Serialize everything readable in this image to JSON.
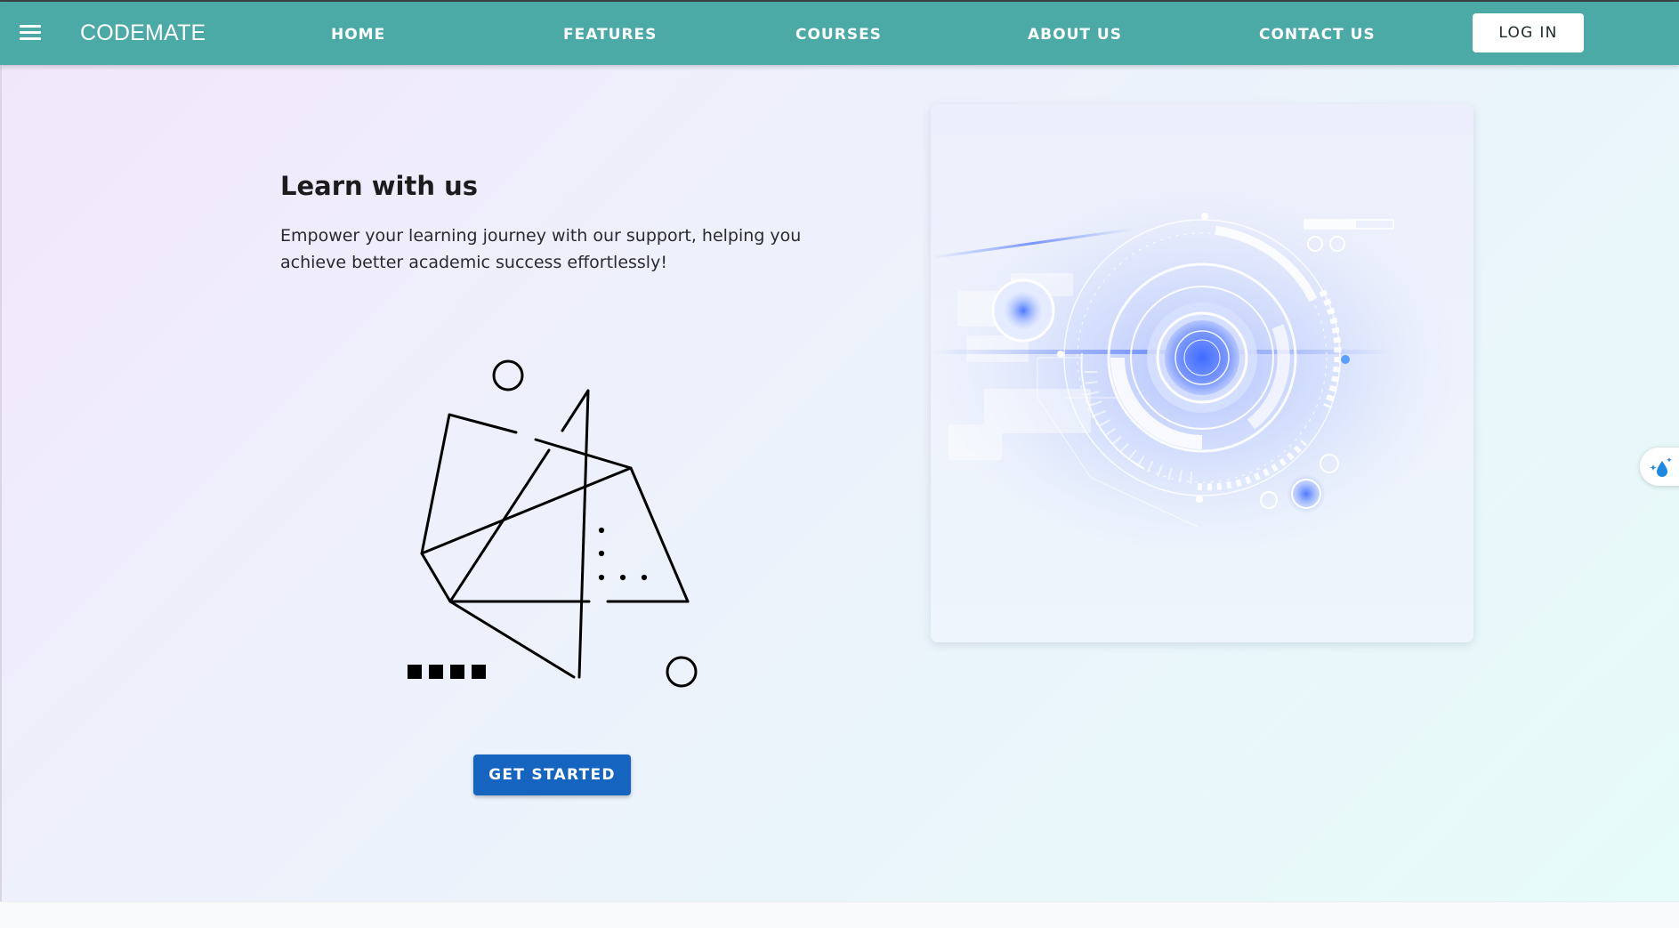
{
  "navbar": {
    "brand": "CODEMATE",
    "links": [
      "HOME",
      "FEATURES",
      "COURSES",
      "ABOUT US",
      "CONTACT US"
    ],
    "login_label": "LOG IN",
    "bg_color": "#4ba9a6"
  },
  "hero": {
    "title": "Learn with us",
    "subtitle": "Empower your learning journey with our support, helping you achieve better academic success effortlessly!",
    "cta_label": "GET STARTED",
    "cta_color": "#1565c0"
  },
  "icons": {
    "menu": "menu-icon",
    "side_widget": "sparkle-drop-icon"
  }
}
